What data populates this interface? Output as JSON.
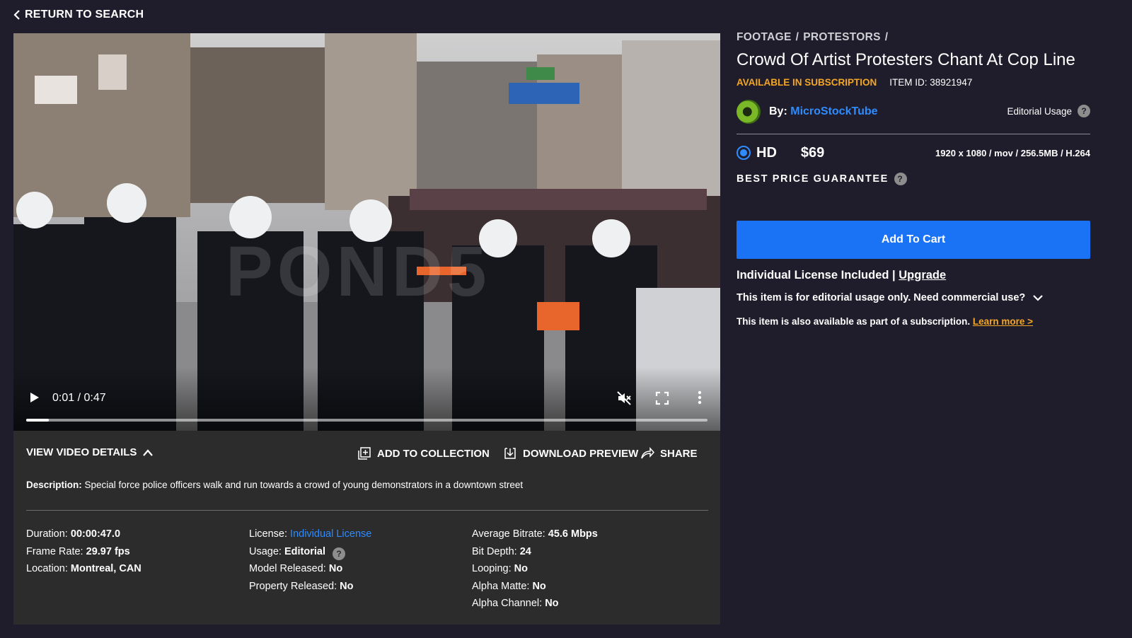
{
  "nav": {
    "back_label": "RETURN TO SEARCH"
  },
  "player": {
    "watermark": "POND5",
    "time": "0:01 / 0:47",
    "progress_fraction": 0.033
  },
  "details_bar": {
    "toggle_label": "VIEW VIDEO DETAILS",
    "add_to_collection": "ADD TO COLLECTION",
    "download_preview": "DOWNLOAD PREVIEW",
    "share": "SHARE"
  },
  "description": {
    "label": "Description:",
    "text": "Special force police officers walk and run towards a crowd of young demonstrators in a downtown street"
  },
  "specs": {
    "col1": [
      {
        "label": "Duration:",
        "value": "00:00:47.0"
      },
      {
        "label": "Frame Rate:",
        "value": "29.97 fps"
      },
      {
        "label": "Location:",
        "value": "Montreal, CAN"
      }
    ],
    "col2": [
      {
        "label": "License:",
        "value": "Individual License"
      },
      {
        "label": "Usage:",
        "value": "Editorial"
      },
      {
        "label": "Model Released:",
        "value": "No"
      },
      {
        "label": "Property Released:",
        "value": "No"
      }
    ],
    "col3": [
      {
        "label": "Average Bitrate:",
        "value": "45.6 Mbps"
      },
      {
        "label": "Bit Depth:",
        "value": "24"
      },
      {
        "label": "Looping:",
        "value": "No"
      },
      {
        "label": "Alpha Matte:",
        "value": "No"
      },
      {
        "label": "Alpha Channel:",
        "value": "No"
      }
    ]
  },
  "product": {
    "breadcrumb": [
      "FOOTAGE",
      "PROTESTORS"
    ],
    "title": "Crowd Of Artist Protesters Chant At Cop Line",
    "availability": "AVAILABLE IN SUBSCRIPTION",
    "item_id": "ITEM ID: 38921947",
    "by_label": "By:",
    "author": "MicroStockTube",
    "editorial_usage": "Editorial Usage",
    "format": "HD",
    "price": "$69",
    "format_specs": "1920 x 1080 / mov / 256.5MB / H.264",
    "best_price": "BEST PRICE GUARANTEE",
    "add_to_cart": "Add To Cart",
    "license_included": "Individual License Included |",
    "upgrade": "Upgrade",
    "editorial_note": "This item is for editorial usage only. Need commercial use?",
    "subscription_note": "This item is also available as part of a subscription.",
    "learn_more": "Learn more >"
  },
  "colors": {
    "background": "#1f1d2b",
    "panel": "#2c2c2c",
    "accent_blue": "#1a73f5",
    "link_blue": "#2d8cff",
    "orange": "#f5a623"
  }
}
